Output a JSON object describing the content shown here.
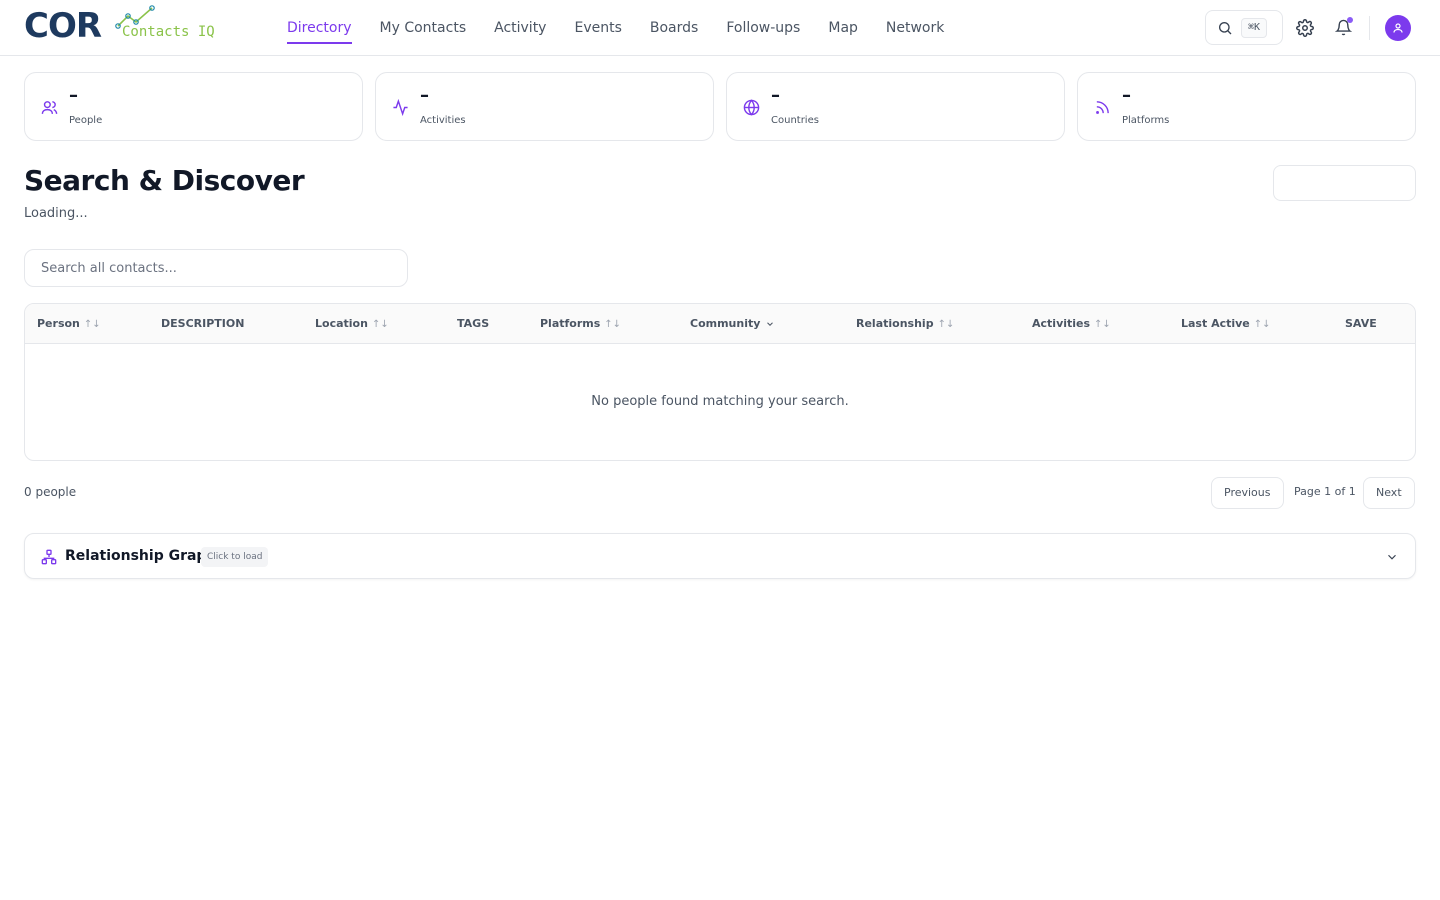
{
  "brand": {
    "name": "COR",
    "tagline": "Contacts IQ"
  },
  "nav": [
    {
      "label": "Directory",
      "active": true
    },
    {
      "label": "My Contacts"
    },
    {
      "label": "Activity"
    },
    {
      "label": "Events"
    },
    {
      "label": "Boards"
    },
    {
      "label": "Follow-ups"
    },
    {
      "label": "Map"
    },
    {
      "label": "Network"
    }
  ],
  "header": {
    "shortcut": "⌘K"
  },
  "stats": [
    {
      "value": "–",
      "label": "People",
      "icon": "users-icon"
    },
    {
      "value": "–",
      "label": "Activities",
      "icon": "activity-icon"
    },
    {
      "value": "–",
      "label": "Countries",
      "icon": "globe-icon"
    },
    {
      "value": "–",
      "label": "Platforms",
      "icon": "rss-icon"
    }
  ],
  "page": {
    "title": "Search & Discover",
    "subtitle": "Loading..."
  },
  "search": {
    "placeholder": "Search all contacts..."
  },
  "table": {
    "columns": [
      "Person",
      "DESCRIPTION",
      "Location",
      "TAGS",
      "Platforms",
      "Community",
      "Relationship",
      "Activities",
      "Last Active",
      "SAVE"
    ],
    "empty_message": "No people found matching your search."
  },
  "footer": {
    "count": "0 people",
    "previous": "Previous",
    "page_info": "Page 1 of 1",
    "next": "Next"
  },
  "graph": {
    "title": "Relationship Graph",
    "badge": "Click to load"
  },
  "colors": {
    "accent": "#7c3aed",
    "brand_dark": "#1e3a5f",
    "brand_green": "#8bc34a"
  }
}
